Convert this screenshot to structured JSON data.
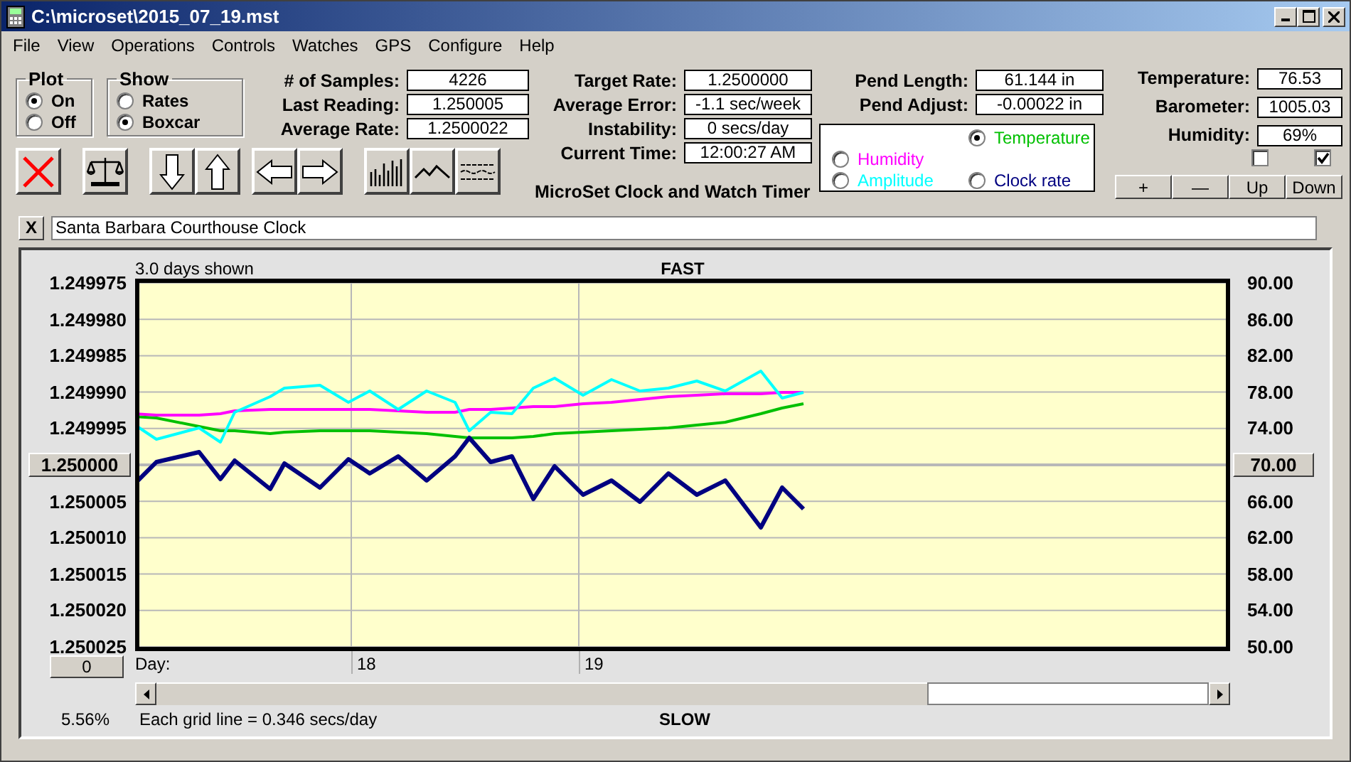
{
  "window": {
    "title": "C:\\microset\\2015_07_19.mst"
  },
  "menu": [
    "File",
    "View",
    "Operations",
    "Controls",
    "Watches",
    "GPS",
    "Configure",
    "Help"
  ],
  "plot_group": {
    "title": "Plot",
    "options": [
      {
        "label": "On",
        "selected": true
      },
      {
        "label": "Off",
        "selected": false
      }
    ]
  },
  "show_group": {
    "title": "Show",
    "options": [
      {
        "label": "Rates",
        "selected": false
      },
      {
        "label": "Boxcar",
        "selected": true
      }
    ]
  },
  "toolbar": [
    {
      "kind": "clear"
    },
    {
      "kind": "balance"
    },
    {
      "kind": "down"
    },
    {
      "kind": "up"
    },
    {
      "kind": "left"
    },
    {
      "kind": "right"
    },
    {
      "kind": "bars"
    },
    {
      "kind": "line"
    },
    {
      "kind": "wave"
    }
  ],
  "readouts_1": [
    {
      "label": "# of Samples:",
      "value": "4226"
    },
    {
      "label": "Last Reading:",
      "value": "1.250005"
    },
    {
      "label": "Average Rate:",
      "value": "1.2500022"
    }
  ],
  "readouts_2": [
    {
      "label": "Target Rate:",
      "value": "1.2500000"
    },
    {
      "label": "Average Error:",
      "value": "-1.1 sec/week"
    },
    {
      "label": "Instability:",
      "value": "0 secs/day"
    },
    {
      "label": "Current Time:",
      "value": "12:00:27 AM"
    }
  ],
  "app_title": "MicroSet Clock and Watch Timer",
  "pendulum": [
    {
      "label": "Pend Length:",
      "value": "61.144 in"
    },
    {
      "label": "Pend Adjust:",
      "value": "-0.00022 in"
    }
  ],
  "trace_selector": [
    {
      "label": "Temperature",
      "selected": true,
      "color": "#00c000"
    },
    {
      "label": "Humidity",
      "selected": false,
      "color": "#ff00ff"
    },
    {
      "label": "Amplitude",
      "selected": false,
      "color": "#00ffff"
    },
    {
      "label": "Clock rate",
      "selected": false,
      "color": "#000080"
    }
  ],
  "environment": [
    {
      "label": "Temperature:",
      "value": "76.53"
    },
    {
      "label": "Barometer:",
      "value": "1005.03"
    },
    {
      "label": "Humidity:",
      "value": "69%"
    }
  ],
  "checkboxes": [
    {
      "checked": false
    },
    {
      "checked": true
    }
  ],
  "scale_buttons": [
    "+",
    "—",
    "Up",
    "Down"
  ],
  "clear_name_button": "X",
  "watch_name": {
    "value": "Santa Barbara Courthouse Clock"
  },
  "graph": {
    "span_label": "3.0 days shown",
    "top_label": "FAST",
    "bottom_label": "SLOW",
    "percent": "5.56%",
    "grid_note": "Each grid line = 0.346 secs/day",
    "offset_button": "0",
    "right_axis": [
      {
        "label": "90.00",
        "kind": "label"
      },
      {
        "label": "86.00",
        "kind": "label"
      },
      {
        "label": "82.00",
        "kind": "label"
      },
      {
        "label": "78.00",
        "kind": "label"
      },
      {
        "label": "74.00",
        "kind": "label"
      },
      {
        "label": "70.00",
        "kind": "button"
      },
      {
        "label": "66.00",
        "kind": "label"
      },
      {
        "label": "62.00",
        "kind": "label"
      },
      {
        "label": "58.00",
        "kind": "label"
      },
      {
        "label": "54.00",
        "kind": "label"
      },
      {
        "label": "50.00",
        "kind": "label"
      }
    ],
    "left_axis": [
      {
        "label": "1.249975",
        "kind": "label"
      },
      {
        "label": "1.249980",
        "kind": "label"
      },
      {
        "label": "1.249985",
        "kind": "label"
      },
      {
        "label": "1.249990",
        "kind": "label"
      },
      {
        "label": "1.249995",
        "kind": "label"
      },
      {
        "label": "1.250000",
        "kind": "button"
      },
      {
        "label": "1.250005",
        "kind": "label"
      },
      {
        "label": "1.250010",
        "kind": "label"
      },
      {
        "label": "1.250015",
        "kind": "label"
      },
      {
        "label": "1.250020",
        "kind": "label"
      },
      {
        "label": "1.250025",
        "kind": "label"
      }
    ],
    "x_axis": {
      "title": "Day:",
      "labels": [
        "18",
        "19"
      ]
    }
  }
}
